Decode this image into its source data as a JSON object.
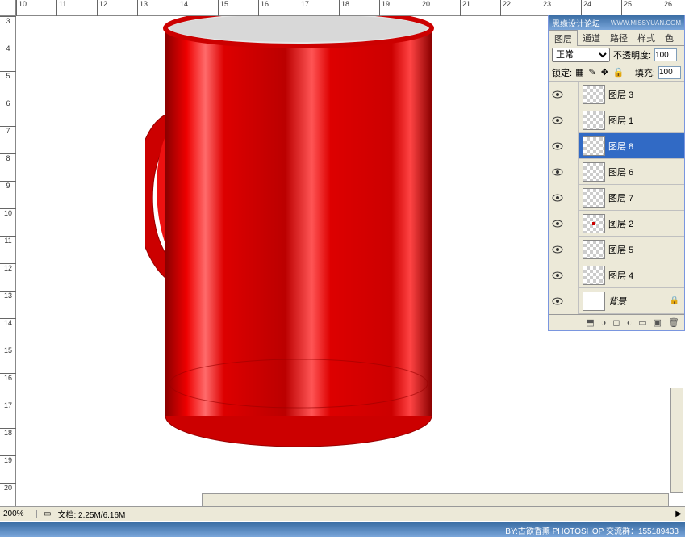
{
  "title_bar": {
    "text": "思缘设计论坛",
    "url_text": "WWW.MISSYUAN.COM"
  },
  "ruler_h": [
    "10",
    "11",
    "12",
    "13",
    "14",
    "15",
    "16",
    "17",
    "18",
    "19",
    "20",
    "21",
    "22",
    "23",
    "24",
    "25",
    "26"
  ],
  "ruler_v": [
    "3",
    "4",
    "5",
    "6",
    "7",
    "8",
    "9",
    "10",
    "11",
    "12",
    "13",
    "14",
    "15",
    "16",
    "17",
    "18",
    "19",
    "20"
  ],
  "panel": {
    "tabs": [
      "图层",
      "通道",
      "路径",
      "样式",
      "色"
    ],
    "blend_mode": "正常",
    "opacity_label": "不透明度:",
    "opacity_value": "100",
    "lock_label": "锁定:",
    "fill_label": "填充:",
    "fill_value": "100"
  },
  "layers": [
    {
      "name": "图层 3",
      "visible": true,
      "selected": false,
      "checker": true
    },
    {
      "name": "图层 1",
      "visible": true,
      "selected": false,
      "checker": true
    },
    {
      "name": "图层 8",
      "visible": true,
      "selected": true,
      "checker": true
    },
    {
      "name": "图层 6",
      "visible": true,
      "selected": false,
      "checker": true
    },
    {
      "name": "图层 7",
      "visible": true,
      "selected": false,
      "checker": true
    },
    {
      "name": "图层 2",
      "visible": true,
      "selected": false,
      "checker": true,
      "dot": true
    },
    {
      "name": "图层 5",
      "visible": true,
      "selected": false,
      "checker": true
    },
    {
      "name": "图层 4",
      "visible": true,
      "selected": false,
      "checker": true
    },
    {
      "name": "背景",
      "visible": true,
      "selected": false,
      "checker": false,
      "bg": true
    }
  ],
  "status": {
    "zoom": "200%",
    "doc_label": "文档:",
    "doc_value": "2.25M/6.16M"
  },
  "footer": {
    "credit": "BY:古欲香薰  PHOTOSHOP 交流群：155189433"
  },
  "colors": {
    "cup_red": "#cc0000",
    "cup_highlight": "#ff3333",
    "cup_dark": "#8b0000"
  }
}
